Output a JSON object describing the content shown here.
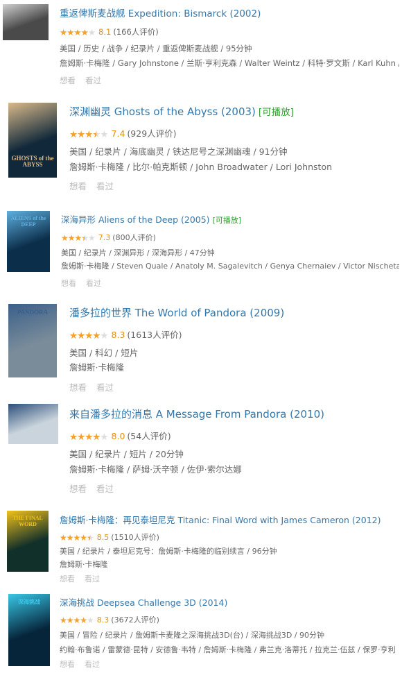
{
  "items": [
    {
      "title": "重返俾斯麦战舰 Expedition: Bismarck (2002)",
      "playable": "",
      "rating": 4.0,
      "score": "8.1",
      "count": "(166人评价)",
      "meta": [
        "美国 / 历史 / 战争 / 纪录片 / 重返俾斯麦战舰 / 95分钟",
        "詹姆斯·卡梅隆 / Gary Johnstone / 兰斯·亨利克森 / Walter Weintz / 科特·罗文斯 / Karl Kuhn /"
      ],
      "want": "想看",
      "seen": "看过",
      "poster": {
        "bg": "#4a4a4a",
        "accent": "#cfcfcf"
      }
    },
    {
      "title": "深渊幽灵 Ghosts of the Abyss (2003)",
      "playable": "[可播放]",
      "rating": 3.5,
      "score": "7.4",
      "count": "(929人评价)",
      "meta": [
        "美国 / 纪录片 / 海底幽灵 / 铁达尼号之深渊幽魂 / 91分钟",
        "詹姆斯·卡梅隆 / 比尔·帕克斯顿 / John Broadwater / Lori Johnston"
      ],
      "want": "想看",
      "seen": "看过",
      "poster": {
        "bg": "#10283a",
        "accent": "#d9b98a",
        "text": "GHOSTS of the ABYSS"
      }
    },
    {
      "title": "深海异形 Aliens of the Deep (2005)",
      "playable": "[可播放]",
      "rating": 3.5,
      "score": "7.3",
      "count": "(800人评价)",
      "meta": [
        "美国 / 纪录片 / 深渊异形 / 深海异形 / 47分钟",
        "詹姆斯·卡梅隆 / Steven Quale / Anatoly M. Sagalevitch / Genya Chernaiev / Victor Nischeta"
      ],
      "want": "想看",
      "seen": "看过",
      "poster": {
        "bg": "#0b2e4a",
        "accent": "#5fb0e0",
        "text": "ALIENS of the DEEP"
      }
    },
    {
      "title": "潘多拉的世界 The World of Pandora (2009)",
      "playable": "",
      "rating": 4.0,
      "score": "8.3",
      "count": "(1613人评价)",
      "meta": [
        "美国 / 科幻 / 短片",
        "詹姆斯·卡梅隆"
      ],
      "want": "想看",
      "seen": "看过",
      "poster": {
        "bg": "#7a8c9a",
        "accent": "#3a5f8a",
        "text": "PANDORA"
      }
    },
    {
      "title": "来自潘多拉的消息 A Message From Pandora (2010)",
      "playable": "",
      "rating": 4.0,
      "score": "8.0",
      "count": "(54人评价)",
      "meta": [
        "美国 / 纪录片 / 短片 / 20分钟",
        "詹姆斯·卡梅隆 / 萨姆·沃辛顿 / 佐伊·索尔达娜"
      ],
      "want": "想看",
      "seen": "看过",
      "poster": {
        "bg": "#c9d4dc",
        "accent": "#2d4e7a"
      }
    },
    {
      "title": "詹姆斯·卡梅隆：再见泰坦尼克 Titanic: Final Word with James Cameron (2012)",
      "playable": "",
      "rating": 4.5,
      "score": "8.5",
      "count": "(1510人评价)",
      "meta": [
        "美国 / 纪录片 / 泰坦尼克号：詹姆斯·卡梅隆的临别续言 / 96分钟",
        "詹姆斯·卡梅隆"
      ],
      "want": "想看",
      "seen": "看过",
      "poster": {
        "bg": "#12302a",
        "accent": "#f2c21b",
        "text": "THE FINAL WORD"
      }
    },
    {
      "title": "深海挑战 Deepsea Challenge 3D (2014)",
      "playable": "",
      "rating": 4.0,
      "score": "8.3",
      "count": "(3672人评价)",
      "meta": [
        "美国 / 冒险 / 纪录片 / 詹姆斯卡麦隆之深海挑战3D(台) / 深海挑战3D / 90分钟",
        "约翰·布鲁诺 / 雷蒙德·昆特 / 安德鲁·韦特 / 詹姆斯·卡梅隆 / 弗兰克·洛蒂托 / 拉克兰·伍兹 / 保罗·亨利"
      ],
      "want": "想看",
      "seen": "看过",
      "poster": {
        "bg": "#06243a",
        "accent": "#38c7e6",
        "text": "深海挑战"
      }
    }
  ]
}
